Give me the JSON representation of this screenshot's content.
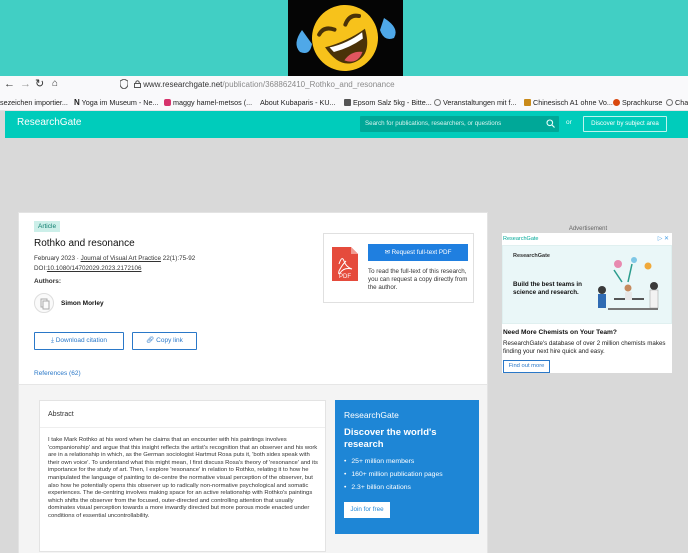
{
  "browser": {
    "url_host": "www.researchgate.net",
    "url_path": "/publication/368862410_Rothko_and_resonance",
    "bookmarks": [
      {
        "label": "sezeichen importier...",
        "color": "#00000000"
      },
      {
        "label": "Yoga im Museum - Ne...",
        "color": "#111111"
      },
      {
        "label": "maggy hamel-metsos (...",
        "color": "#d6336c"
      },
      {
        "label": "About Kubaparis - KU...",
        "color": "#888888"
      },
      {
        "label": "Epsom Salz 5kg - Bitte...",
        "color": "#555555"
      },
      {
        "label": "Veranstaltungen mit f...",
        "color": "#777777"
      },
      {
        "label": "Chinesisch A1 ohne Vo...",
        "color": "#c98a1a"
      },
      {
        "label": "Sprachkurse",
        "color": "#d9480f"
      },
      {
        "label": "Chan",
        "color": "#888888"
      }
    ]
  },
  "header": {
    "logo": "ResearchGate",
    "search_placeholder": "Search for publications, researchers, or questions",
    "or": "or",
    "discover": "Discover by subject area"
  },
  "article": {
    "badge": "Article",
    "title": "Rothko and resonance",
    "date": "February 2023 · ",
    "journal": "Journal of Visual Art Practice",
    "volume": " 22(1):75-92",
    "doi_label": "DOI:",
    "doi": "10.1080/14702029.2023.2172106",
    "authors_label": "Authors:",
    "author": "Simon Morley",
    "download_btn": "Download citation",
    "copy_btn": "Copy link",
    "references": "References (62)"
  },
  "request": {
    "button": "Request full-text PDF",
    "text": "To read the full-text of this research, you can request a copy directly from the author."
  },
  "abstract": {
    "heading": "Abstract",
    "body": "I take Mark Rothko at his word when he claims that an encounter with his paintings involves 'companionship' and argue that this insight reflects the artist's recognition that an observer and his work are in a relationship in which, as the German sociologist Hartmut Rosa puts it, 'both sides speak with their own voice'. To understand what this might mean, I first discuss Rosa's theory of 'resonance' and its importance for the study of art. Then, I explore 'resonance' in relation to Rothko, relating it to how he manipulated the language of painting to de-centre the normative visual perception of the observer, but also how he potentially opens this observer up to radically non-normative psychological and somatic experiences. The de-centring involves making space for an active relationship with Rothko's paintings which shifts the observer from the focused, outer-directed and controlling attention that usually dominates visual perception towards a more inwardly directed but more porous mode enacted under conditions of essential uncontrollability."
  },
  "promo": {
    "logo": "ResearchGate",
    "heading": "Discover the world's research",
    "items": [
      "25+ million members",
      "160+ million publication pages",
      "2.3+ billion citations"
    ],
    "button": "Join for free"
  },
  "ad": {
    "label": "Advertisement",
    "source": "ResearchGate",
    "info": "▷ ✕",
    "banner_logo": "ResearchGate",
    "banner_text": "Build the best teams in science and research.",
    "headline": "Need More Chemists on Your Team?",
    "description": "ResearchGate's database of over 2 million chemists makes finding your next hire quick and easy.",
    "button": "Find out more"
  }
}
